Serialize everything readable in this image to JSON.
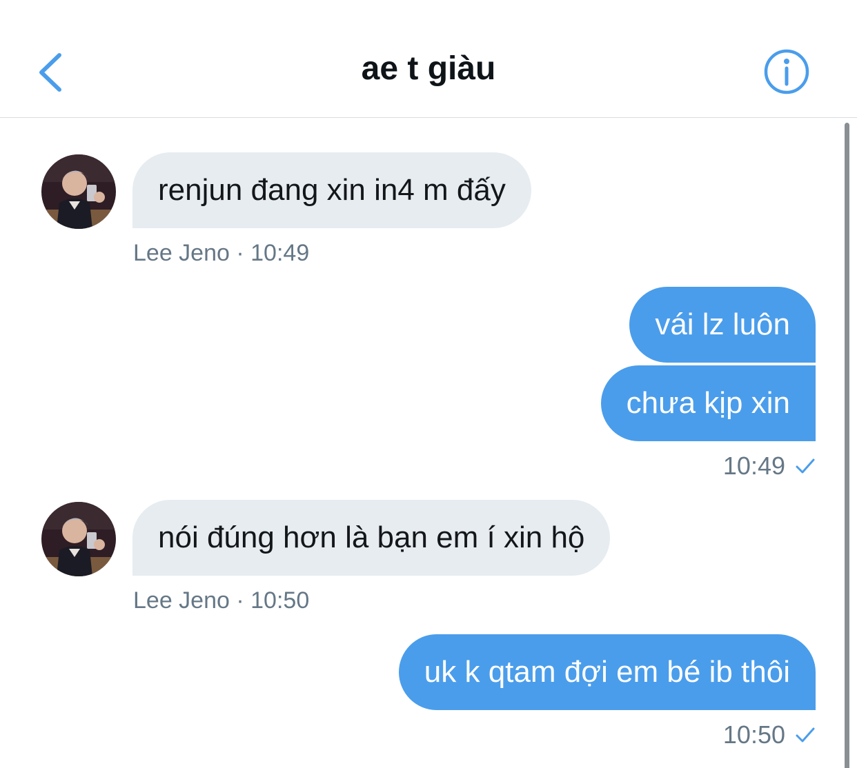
{
  "header": {
    "title": "ae t giàu",
    "back_icon": "chevron-left-icon",
    "info_icon": "info-icon",
    "accent_color": "#4a9deb"
  },
  "messages": [
    {
      "direction": "incoming",
      "text": "renjun đang xin in4 m đấy",
      "sender": "Lee Jeno",
      "separator": "·",
      "time": "10:49"
    },
    {
      "direction": "outgoing",
      "text": "vái lz luôn"
    },
    {
      "direction": "outgoing",
      "text": "chưa kịp xin",
      "time": "10:49",
      "status_icon": "check-icon"
    },
    {
      "direction": "incoming",
      "text": "nói đúng hơn là bạn em í xin hộ",
      "sender": "Lee Jeno",
      "separator": "·",
      "time": "10:50"
    },
    {
      "direction": "outgoing",
      "text": "uk k qtam đợi em bé ib thôi",
      "time": "10:50",
      "status_icon": "check-icon"
    }
  ],
  "colors": {
    "incoming_bubble": "#e6ecf0",
    "outgoing_bubble": "#4a9deb",
    "meta_text": "#657786"
  }
}
